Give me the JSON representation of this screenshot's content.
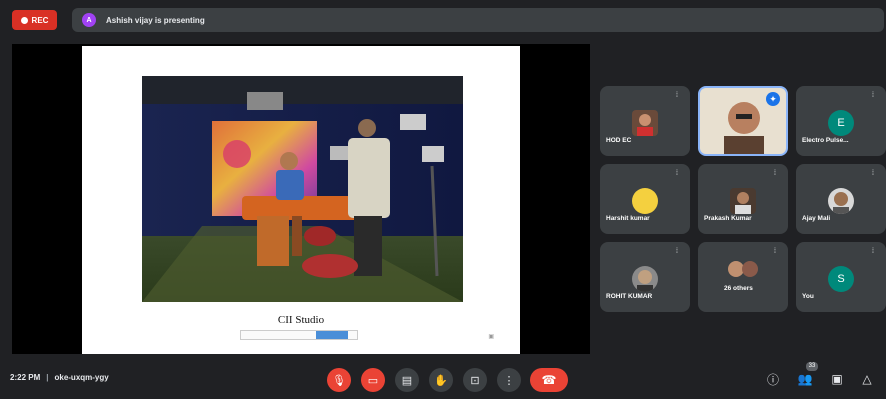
{
  "top": {
    "rec_label": "REC",
    "presenter_initial": "A",
    "presenting_text": "Ashish vijay is presenting"
  },
  "slide": {
    "caption": "CII Studio"
  },
  "participants": [
    {
      "name": "HOD EC",
      "type": "photo"
    },
    {
      "name": "",
      "type": "active-speaker"
    },
    {
      "name": "Electro Pulse...",
      "type": "initial",
      "initial": "E",
      "color": "#00897b"
    },
    {
      "name": "Harshit kumar",
      "type": "dot",
      "color": "#f4d03f"
    },
    {
      "name": "Prakash Kumar",
      "type": "photo"
    },
    {
      "name": "Ajay Mali",
      "type": "photo"
    },
    {
      "name": "ROHIT KUMAR",
      "type": "photo"
    },
    {
      "name": "26 others",
      "type": "group"
    },
    {
      "name": "You",
      "type": "initial",
      "initial": "S",
      "color": "#00897b"
    }
  ],
  "bottom": {
    "time": "2:22 PM",
    "meeting_code": "oke-uxqm-ygy",
    "people_count": "33"
  },
  "icons": {
    "mic": "mic-off-icon",
    "camera": "camera-off-icon",
    "captions": "captions-icon",
    "hand": "raise-hand-icon",
    "present": "present-screen-icon",
    "more": "more-options-icon",
    "end": "end-call-icon",
    "info": "info-icon",
    "people": "people-icon",
    "chat": "chat-icon",
    "activities": "activities-icon"
  },
  "colors": {
    "background": "#202124",
    "tile": "#3c4043",
    "red": "#ea4335",
    "accent": "#8ab4f8"
  }
}
